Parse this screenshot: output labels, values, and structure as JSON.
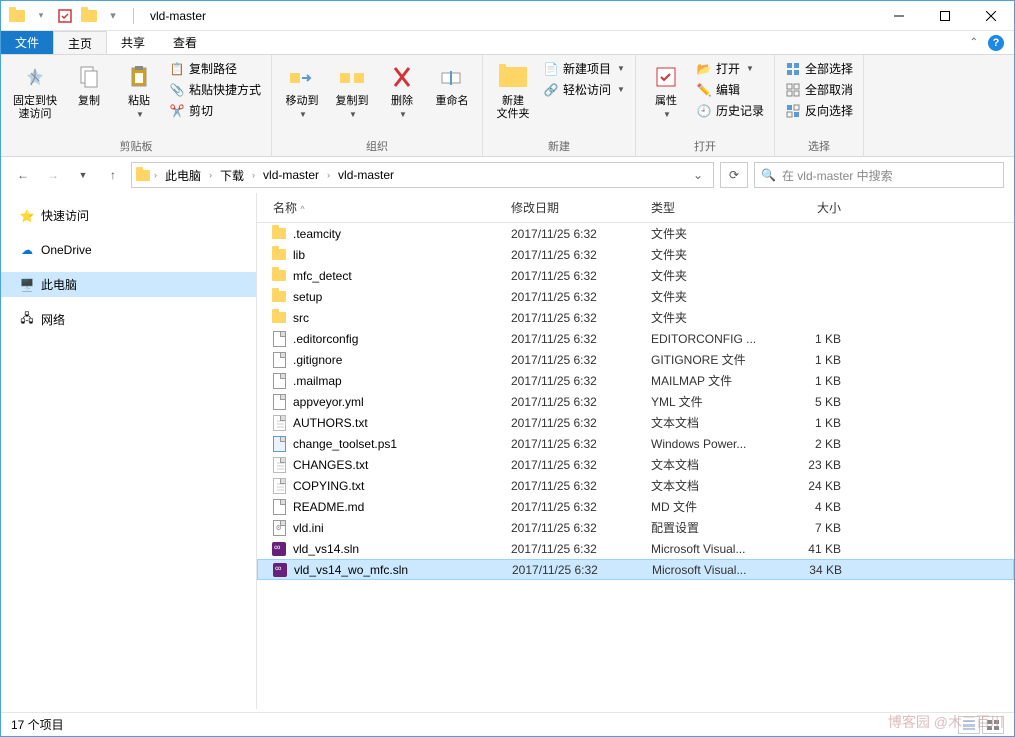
{
  "title": "vld-master",
  "tabs": {
    "file": "文件",
    "home": "主页",
    "share": "共享",
    "view": "查看"
  },
  "ribbon": {
    "pin": "固定到快\n速访问",
    "copy": "复制",
    "paste": "粘贴",
    "copy_path": "复制路径",
    "paste_shortcut": "粘贴快捷方式",
    "cut": "剪切",
    "clipboard_group": "剪贴板",
    "move_to": "移动到",
    "copy_to": "复制到",
    "delete": "删除",
    "rename": "重命名",
    "organize_group": "组织",
    "new_folder": "新建\n文件夹",
    "new_item": "新建项目",
    "easy_access": "轻松访问",
    "new_group": "新建",
    "properties": "属性",
    "open": "打开",
    "edit": "编辑",
    "history": "历史记录",
    "open_group": "打开",
    "select_all": "全部选择",
    "select_none": "全部取消",
    "invert": "反向选择",
    "select_group": "选择"
  },
  "breadcrumbs": [
    "此电脑",
    "下载",
    "vld-master",
    "vld-master"
  ],
  "search_placeholder": "在 vld-master 中搜索",
  "nav": {
    "quick": "快速访问",
    "onedrive": "OneDrive",
    "thispc": "此电脑",
    "network": "网络"
  },
  "columns": {
    "name": "名称",
    "date": "修改日期",
    "type": "类型",
    "size": "大小"
  },
  "files": [
    {
      "icon": "folder",
      "name": ".teamcity",
      "date": "2017/11/25 6:32",
      "type": "文件夹",
      "size": ""
    },
    {
      "icon": "folder",
      "name": "lib",
      "date": "2017/11/25 6:32",
      "type": "文件夹",
      "size": ""
    },
    {
      "icon": "folder",
      "name": "mfc_detect",
      "date": "2017/11/25 6:32",
      "type": "文件夹",
      "size": ""
    },
    {
      "icon": "folder",
      "name": "setup",
      "date": "2017/11/25 6:32",
      "type": "文件夹",
      "size": ""
    },
    {
      "icon": "folder",
      "name": "src",
      "date": "2017/11/25 6:32",
      "type": "文件夹",
      "size": ""
    },
    {
      "icon": "file",
      "name": ".editorconfig",
      "date": "2017/11/25 6:32",
      "type": "EDITORCONFIG ...",
      "size": "1 KB"
    },
    {
      "icon": "file",
      "name": ".gitignore",
      "date": "2017/11/25 6:32",
      "type": "GITIGNORE 文件",
      "size": "1 KB"
    },
    {
      "icon": "file",
      "name": ".mailmap",
      "date": "2017/11/25 6:32",
      "type": "MAILMAP 文件",
      "size": "1 KB"
    },
    {
      "icon": "file",
      "name": "appveyor.yml",
      "date": "2017/11/25 6:32",
      "type": "YML 文件",
      "size": "5 KB"
    },
    {
      "icon": "txt",
      "name": "AUTHORS.txt",
      "date": "2017/11/25 6:32",
      "type": "文本文档",
      "size": "1 KB"
    },
    {
      "icon": "ps1",
      "name": "change_toolset.ps1",
      "date": "2017/11/25 6:32",
      "type": "Windows Power...",
      "size": "2 KB"
    },
    {
      "icon": "txt",
      "name": "CHANGES.txt",
      "date": "2017/11/25 6:32",
      "type": "文本文档",
      "size": "23 KB"
    },
    {
      "icon": "txt",
      "name": "COPYING.txt",
      "date": "2017/11/25 6:32",
      "type": "文本文档",
      "size": "24 KB"
    },
    {
      "icon": "file",
      "name": "README.md",
      "date": "2017/11/25 6:32",
      "type": "MD 文件",
      "size": "4 KB"
    },
    {
      "icon": "ini",
      "name": "vld.ini",
      "date": "2017/11/25 6:32",
      "type": "配置设置",
      "size": "7 KB"
    },
    {
      "icon": "sln",
      "name": "vld_vs14.sln",
      "date": "2017/11/25 6:32",
      "type": "Microsoft Visual...",
      "size": "41 KB"
    },
    {
      "icon": "sln",
      "name": "vld_vs14_wo_mfc.sln",
      "date": "2017/11/25 6:32",
      "type": "Microsoft Visual...",
      "size": "34 KB",
      "selected": true
    }
  ],
  "status": "17 个项目",
  "watermark": "博客园 @木三百川"
}
